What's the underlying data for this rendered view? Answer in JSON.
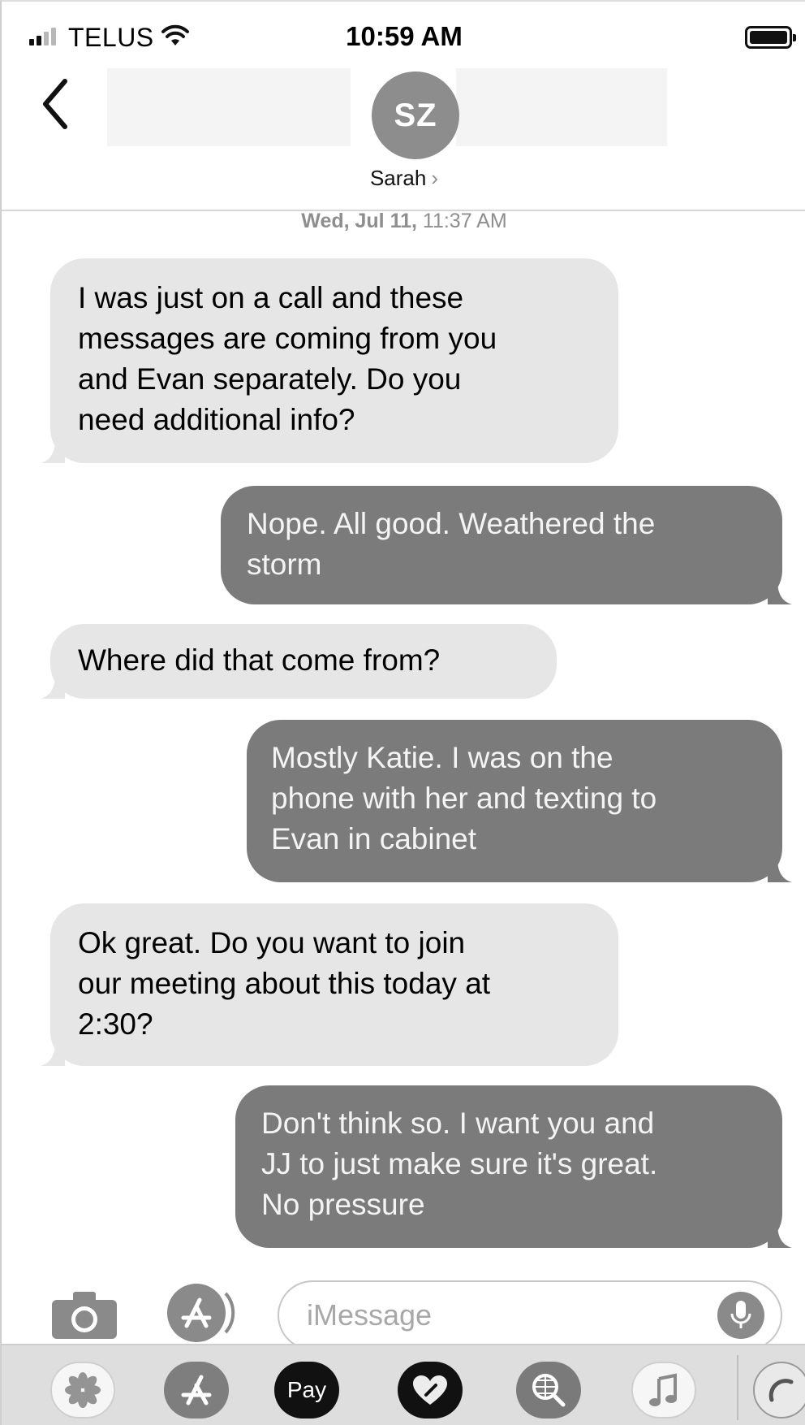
{
  "status_bar": {
    "carrier": "TELUS",
    "time": "10:59 AM",
    "icons": [
      "signal-icon",
      "wifi-icon",
      "battery-icon"
    ]
  },
  "header": {
    "avatar_initials": "SZ",
    "contact_name": "Sarah",
    "chevron": "›",
    "icons": [
      "back-chevron-icon"
    ]
  },
  "conversation": {
    "timestamp_day": "Wed, Jul 11,",
    "timestamp_time": "11:37 AM",
    "messages": [
      {
        "direction": "incoming",
        "lines": [
          "I was just on a call and these",
          "messages are coming from you",
          "and Evan separately. Do you",
          "need additional info?"
        ]
      },
      {
        "direction": "outgoing",
        "lines": [
          "Nope. All good. Weathered the",
          "storm"
        ]
      },
      {
        "direction": "incoming",
        "lines": [
          "Where did that come from?"
        ]
      },
      {
        "direction": "outgoing",
        "lines": [
          "Mostly Katie. I was on the",
          "phone with her and texting to",
          "Evan in cabinet"
        ]
      },
      {
        "direction": "incoming",
        "lines": [
          "Ok great. Do you want to join",
          "our meeting about this today at",
          "2:30?"
        ]
      },
      {
        "direction": "outgoing",
        "lines": [
          "Don't think so. I want you and",
          "JJ to just make sure it's great.",
          "No pressure"
        ]
      }
    ]
  },
  "input_bar": {
    "placeholder": "iMessage",
    "icons": [
      "camera-icon",
      "app-store-icon",
      "microphone-icon"
    ]
  },
  "app_drawer": {
    "pay_label": "Pay",
    "apple_glyph": "",
    "icons": [
      "photos-icon",
      "app-store-icon",
      "apple-pay-icon",
      "heart-sticker-icon",
      "image-search-icon",
      "music-icon",
      "more-apps-icon"
    ]
  },
  "colors": {
    "incoming_bubble": "#e6e6e6",
    "outgoing_bubble": "#7b7b7b",
    "avatar": "#8d8d8d",
    "timestamp": "#8e8e8e"
  }
}
